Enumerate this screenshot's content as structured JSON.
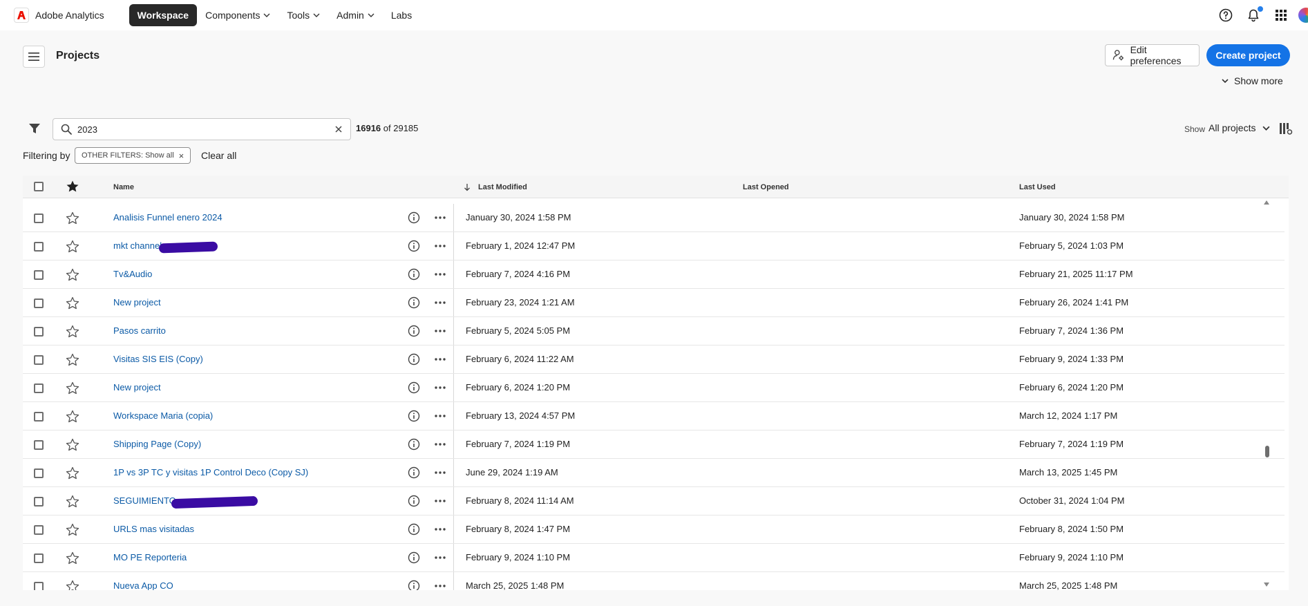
{
  "app": {
    "brand": "Adobe Analytics",
    "nav": [
      {
        "label": "Workspace",
        "active": true,
        "dropdown": false
      },
      {
        "label": "Components",
        "active": false,
        "dropdown": true
      },
      {
        "label": "Tools",
        "active": false,
        "dropdown": true
      },
      {
        "label": "Admin",
        "active": false,
        "dropdown": true
      },
      {
        "label": "Labs",
        "active": false,
        "dropdown": false
      }
    ],
    "icons": [
      "help-icon",
      "notifications-icon",
      "apps-grid-icon",
      "user-avatar"
    ]
  },
  "header": {
    "title": "Projects",
    "edit_preferences": "Edit preferences",
    "create_project": "Create project",
    "show_more": "Show more"
  },
  "filters": {
    "search_value": "2023",
    "count_shown": "16916",
    "count_of": "of 29185",
    "show_label": "Show",
    "show_value": "All projects",
    "filtering_by": "Filtering by",
    "chip_label": "OTHER FILTERS: Show all",
    "clear_all": "Clear all"
  },
  "table": {
    "columns": {
      "name": "Name",
      "last_modified": "Last Modified",
      "last_opened": "Last Opened",
      "last_used": "Last Used"
    },
    "rows": [
      {
        "name": "Analisis Funnel enero 2024",
        "last_modified": "January 30, 2024 1:58 PM",
        "last_used": "January 30, 2024 1:58 PM"
      },
      {
        "name": "mkt channel",
        "last_modified": "February 1, 2024 12:47 PM",
        "last_used": "February 5, 2024 1:03 PM"
      },
      {
        "name": "Tv&Audio",
        "last_modified": "February 7, 2024 4:16 PM",
        "last_used": "February 21, 2025 11:17 PM"
      },
      {
        "name": "New project",
        "last_modified": "February 23, 2024 1:21 AM",
        "last_used": "February 26, 2024 1:41 PM"
      },
      {
        "name": "Pasos carrito",
        "last_modified": "February 5, 2024 5:05 PM",
        "last_used": "February 7, 2024 1:36 PM"
      },
      {
        "name": "Visitas SIS EIS (Copy)",
        "last_modified": "February 6, 2024 11:22 AM",
        "last_used": "February 9, 2024 1:33 PM"
      },
      {
        "name": "New project",
        "last_modified": "February 6, 2024 1:20 PM",
        "last_used": "February 6, 2024 1:20 PM"
      },
      {
        "name": "Workspace Maria (copia)",
        "last_modified": "February 13, 2024 4:57 PM",
        "last_used": "March 12, 2024 1:17 PM"
      },
      {
        "name": "Shipping Page (Copy)",
        "last_modified": "February 7, 2024 1:19 PM",
        "last_used": "February 7, 2024 1:19 PM"
      },
      {
        "name": "1P vs 3P TC y visitas 1P Control Deco (Copy SJ)",
        "last_modified": "June 29, 2024 1:19 AM",
        "last_used": "March 13, 2025 1:45 PM"
      },
      {
        "name": "SEGUIMIENTO",
        "last_modified": "February 8, 2024 11:14 AM",
        "last_used": "October 31, 2024 1:04 PM"
      },
      {
        "name": "URLS mas visitadas",
        "last_modified": "February 8, 2024 1:47 PM",
        "last_used": "February 8, 2024 1:50 PM"
      },
      {
        "name": "MO PE Reporteria",
        "last_modified": "February 9, 2024 1:10 PM",
        "last_used": "February 9, 2024 1:10 PM"
      },
      {
        "name": "Nueva App CO",
        "last_modified": "March 25, 2025 1:48 PM",
        "last_used": "March 25, 2025 1:48 PM"
      }
    ]
  },
  "colors": {
    "accent": "#1473e6",
    "link": "#0b5aa6",
    "active_nav": "#292929"
  }
}
